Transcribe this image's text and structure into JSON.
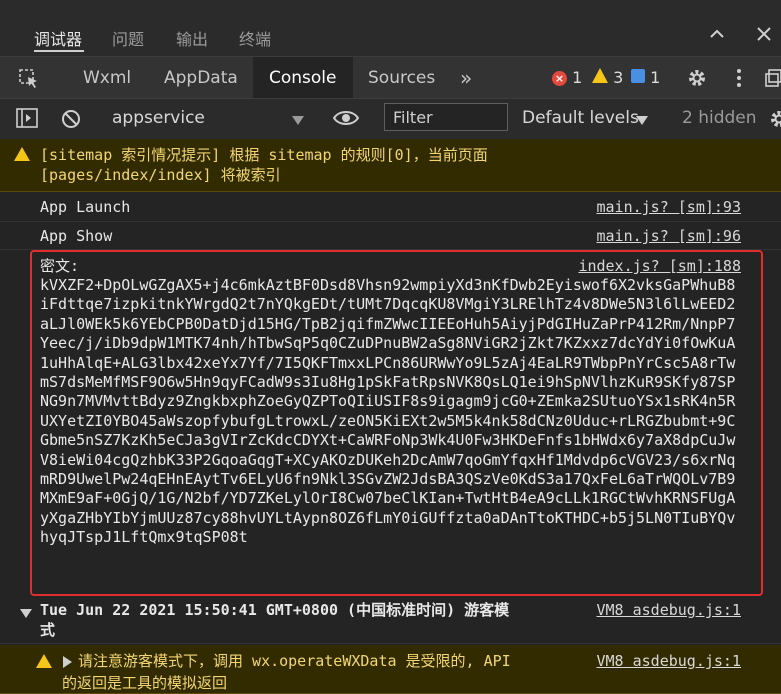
{
  "top_tabs": [
    "调试器",
    "问题",
    "输出",
    "终端"
  ],
  "dev_tabs": [
    "Wxml",
    "AppData",
    "Console",
    "Sources"
  ],
  "counters": {
    "errors": "1",
    "warnings": "3",
    "info": "1"
  },
  "toolbar": {
    "context": "appservice",
    "filter_placeholder": "Filter",
    "levels": "Default levels",
    "hidden": "2 hidden"
  },
  "messages": {
    "sitemap_line1": "[sitemap 索引情况提示] 根据 sitemap 的规则[0]，当前页面",
    "sitemap_line2": "[pages/index/index] 将被索引",
    "launch": "App Launch",
    "launch_src": "main.js? [sm]:93",
    "show": "App Show",
    "show_src": "main.js? [sm]:96",
    "cipher_label": "密文:",
    "cipher_src": "index.js? [sm]:188",
    "cipher_text": "kVXZF2+DpOLwGZgAX5+j4c6mkAztBF0Dsd8Vhsn92wmpiyXd3nKfDwb2Eyiswof6X2vksGaPWhuB8iFdttqe7izpkitnkYWrgdQ2t7nYQkgEDt/tUMt7DqcqKU8VMgiY3LRElhTz4v8DWe5N3l6lLwEED2aLJl0WEk5k6YEbCPB0DatDjd15HG/TpB2jqifmZWwcIIEEoHuh5AiyjPdGIHuZaPrP412Rm/NnpP7Yeec/j/iDb9dpW1MTK74nh/hTbwSqP5q0CZuDPnuBW2aSg8NViGR2jZkt7KZxxz7dcYdYi0fOwKuA1uHhAlqE+ALG3lbx42xeYx7Yf/7I5QKFTmxxLPCn86URWwYo9L5zAj4EaLR9TWbpPnYrCsc5A8rTwmS7dsMeMfMSF9O6w5Hn9qyFCadW9s3Iu8Hg1pSkFatRpsNVK8QsLQ1ei9hSpNVlhzKuR9SKfy87SPNG9n7MVMvttBdyz9ZngkbxphZoeGyQZPToQIiUSIF8s9igagm9jcG0+ZEmka2SUtuoYSx1sRK4n5RUXYetZI0YBO45aWszopfybufgLtrowxL/zeON5KiEXt2w5M5k4nk58dCNz0Uduc+rLRGZbubmt+9CGbme5nSZ7KzKh5eCJa3gVIrZcKdcCDYXt+CaWRFoNp3Wk4U0Fw3HKDeFnfs1bHWdx6y7aX8dpCuJwV8ieWi04cgQzhbK33P2GqoaGqgT+XCyAKOzDUKeh2DcAmW7qoGmYfqxHf1Mdvdp6cVGV23/s6xrNqmRD9UwelPw24qEHnEAytTv6ELyU6fn9Nkl3SGvZW2JdsBA3QSzVe0KdS3a17QxFeL6aTrWQOLv7B9MXmE9aF+0GjQ/1G/N2bf/YD7ZKeLylOrI8Cw07beClKIan+TwtHtB4eA9cLLk1RGCtWvhKRNSFUgAyXgaZHbYIbYjmUUz87cy88hvUYLtAypn8OZ6fLmY0iGUffzta0aDAnTtoKTHDC+b5j5LN0TIuBYQvhyqJTspJ1LftQmx9tqSP08t",
    "time_line1": "Tue Jun 22 2021 15:50:41 GMT+0800 (中国标准时间) 游客模",
    "time_line2": "式",
    "time_src": "VM8 asdebug.js:1",
    "guest_line1": "请注意游客模式下，调用 wx.operateWXData 是受限的, API",
    "guest_line2": "的返回是工具的模拟返回",
    "guest_src": "VM8 asdebug.js:1"
  },
  "colors": {
    "accent_red": "#e02e2e",
    "warning": "#f5c518",
    "info": "#4a90e2"
  }
}
